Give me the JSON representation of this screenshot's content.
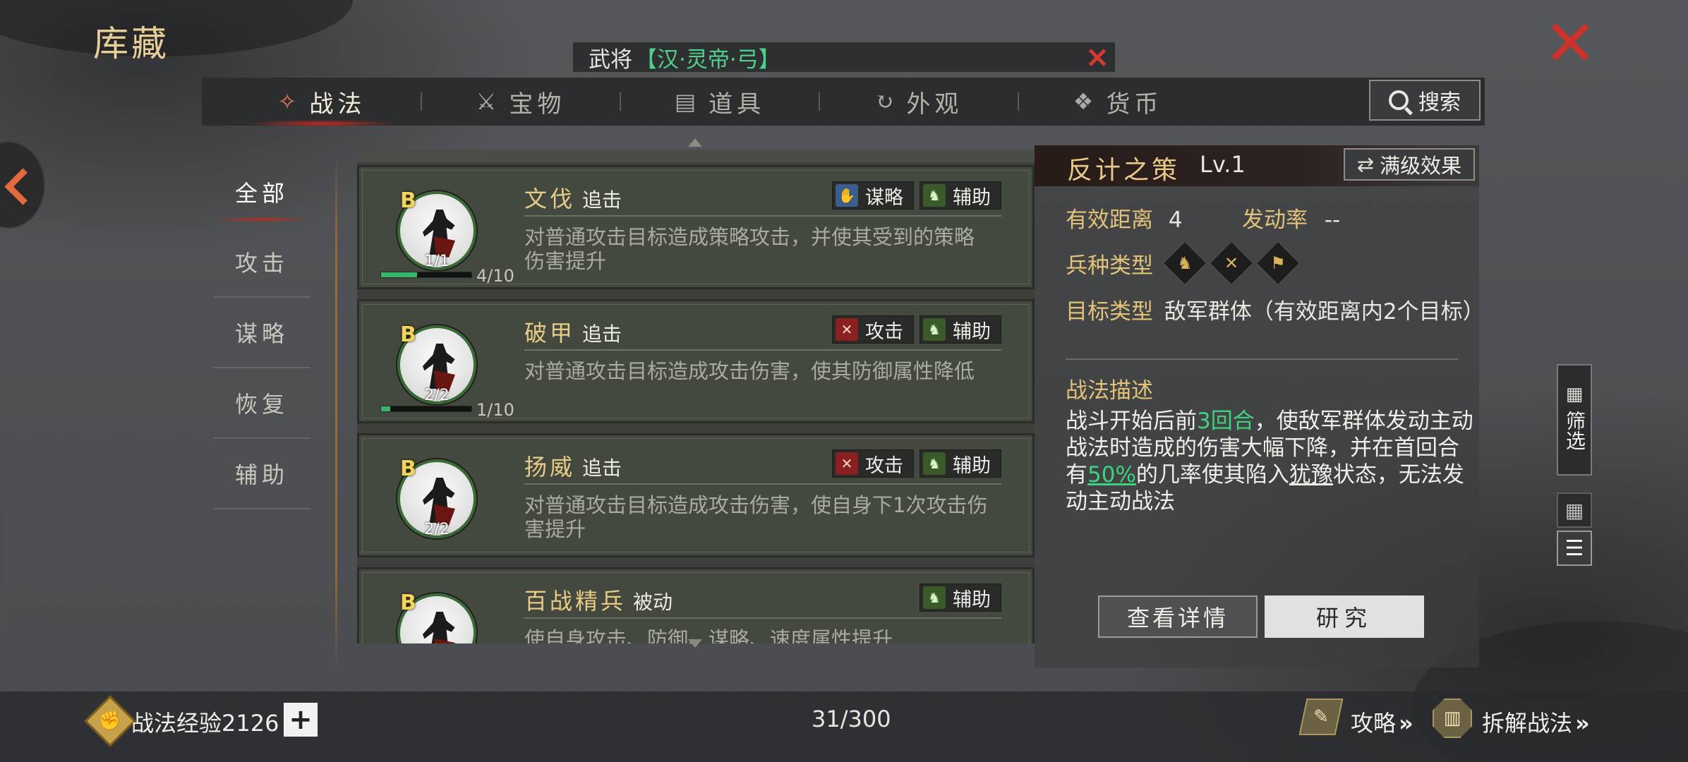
{
  "page_title": "库藏",
  "general_banner": {
    "name": "武将",
    "detail": "【汉·灵帝·弓】"
  },
  "tabs": [
    {
      "label": "战法",
      "icon": "scroll-icon",
      "glyph": "✧"
    },
    {
      "label": "宝物",
      "icon": "treasure-icon",
      "glyph": "⚔"
    },
    {
      "label": "道具",
      "icon": "item-icon",
      "glyph": "▤"
    },
    {
      "label": "外观",
      "icon": "appearance-icon",
      "glyph": "↻"
    },
    {
      "label": "货币",
      "icon": "currency-icon",
      "glyph": "❖"
    }
  ],
  "search_label": "搜索",
  "categories": [
    "全部",
    "攻击",
    "谋略",
    "恢复",
    "辅助"
  ],
  "tactics": [
    {
      "rank": "B",
      "name": "文伐",
      "type": "追击",
      "count": "1/1",
      "level_text": "4/10",
      "level_progress": 0.4,
      "tags": [
        {
          "label": "谋略",
          "kind": "strategy",
          "glyph": "✋"
        },
        {
          "label": "辅助",
          "kind": "support",
          "glyph": "♞"
        }
      ],
      "desc": "对普通攻击目标造成策略攻击，并使其受到的策略伤害提升"
    },
    {
      "rank": "B",
      "name": "破甲",
      "type": "追击",
      "count": "2/2",
      "level_text": "1/10",
      "level_progress": 0.1,
      "tags": [
        {
          "label": "攻击",
          "kind": "attack",
          "glyph": "✕"
        },
        {
          "label": "辅助",
          "kind": "support",
          "glyph": "♞"
        }
      ],
      "desc": "对普通攻击目标造成攻击伤害，使其防御属性降低"
    },
    {
      "rank": "B",
      "name": "扬威",
      "type": "追击",
      "count": "2/2",
      "level_text": "",
      "level_progress": null,
      "tags": [
        {
          "label": "攻击",
          "kind": "attack",
          "glyph": "✕"
        },
        {
          "label": "辅助",
          "kind": "support",
          "glyph": "♞"
        }
      ],
      "desc": "对普通攻击目标造成攻击伤害，使自身下1次攻击伤害提升"
    },
    {
      "rank": "B",
      "name": "百战精兵",
      "type": "被动",
      "count": "",
      "level_text": "",
      "level_progress": null,
      "tags": [
        {
          "label": "辅助",
          "kind": "support",
          "glyph": "♞"
        }
      ],
      "desc": "使自身攻击、防御、谋略、速度属性提升"
    }
  ],
  "detail": {
    "name": "反计之策",
    "level": "Lv.1",
    "max_effect_label": "满级效果",
    "range_label": "有效距离",
    "range_value": "4",
    "rate_label": "发动率",
    "rate_value": "--",
    "troop_label": "兵种类型",
    "troops": [
      "cavalry-icon",
      "archer-icon",
      "infantry-icon"
    ],
    "target_label": "目标类型",
    "target_value": "敌军群体（有效距离内2个目标）",
    "desc_title": "战法描述",
    "desc_parts": {
      "p1": "战斗开始后前",
      "h1": "3回合",
      "p2": "，使敌军群体发动主动战法时造成的伤害大幅下降，并在首回合有",
      "h2": "50%",
      "p3": "的几率使其陷入",
      "u1": "犹豫",
      "p4": "状态，无法发动主动战法"
    },
    "btn_view": "查看详情",
    "btn_research": "研究"
  },
  "filter_label": "筛选",
  "bottom": {
    "exp_label": "战法经验2126",
    "plus": "+",
    "count": "31/300",
    "guide": "攻略",
    "dismantle": "拆解战法"
  },
  "colors": {
    "accent_red": "#c8332d",
    "highlight_green": "#3fd27e",
    "gold": "#e3c27a"
  }
}
